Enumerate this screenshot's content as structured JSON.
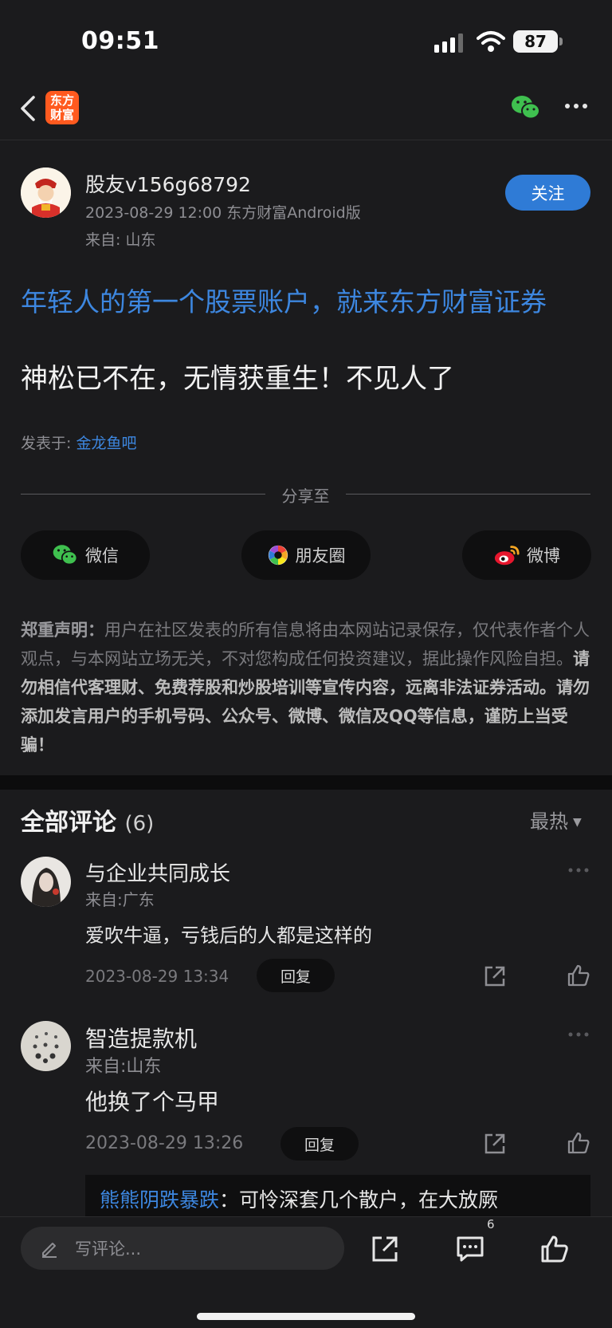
{
  "status_bar": {
    "time": "09:51",
    "battery": "87"
  },
  "nav": {
    "logo_line1": "东方",
    "logo_line2": "财富"
  },
  "post": {
    "author": "股友v156g68792",
    "meta": "2023-08-29 12:00 东方财富Android版",
    "location": "来自: 山东",
    "follow_label": "关注",
    "ad_text": "年轻人的第一个股票账户，就来东方财富证券",
    "content": "神松已不在，无情获重生！不见人了",
    "posted_in_label": "发表于:",
    "bar_name": "金龙鱼吧"
  },
  "share": {
    "label": "分享至",
    "wechat": "微信",
    "moments": "朋友圈",
    "weibo": "微博"
  },
  "disclaimer": {
    "title": "郑重声明：",
    "part1": "用户在社区发表的所有信息将由本网站记录保存，仅代表作者个人观点，与本网站立场无关，不对您构成任何投资建议，据此操作风险自担。",
    "part2": "请勿相信代客理财、免费荐股和炒股培训等宣传内容，远离非法证券活动。请勿添加发言用户的手机号码、公众号、微博、微信及QQ等信息，谨防上当受骗！"
  },
  "comments": {
    "title": "全部评论",
    "count": "(6)",
    "sort": "最热",
    "items": [
      {
        "user": "与企业共同成长",
        "location": "来自:广东",
        "text": "爱吹牛逼，亏钱后的人都是这样的",
        "time": "2023-08-29 13:34",
        "reply_label": "回复"
      },
      {
        "user": "智造提款机",
        "location": "来自:山东",
        "text": "他换了个马甲",
        "time": "2023-08-29 13:26",
        "reply_label": "回复"
      }
    ],
    "sub_reply": {
      "user": "熊熊阴跌暴跌",
      "sep": "：",
      "text": "可怜深套几个散户，在大放厥"
    }
  },
  "bottom": {
    "input_placeholder": "写评论...",
    "comments_badge": "6"
  }
}
